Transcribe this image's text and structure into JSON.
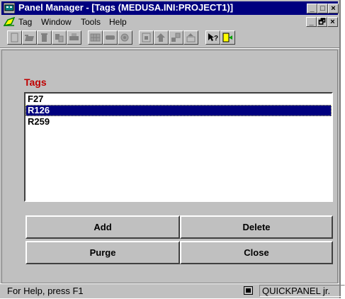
{
  "window": {
    "title": "Panel Manager - [Tags (MEDUSA.INI:PROJECT1)]",
    "minimize_label": "_",
    "restore_label": "□",
    "close_label": "×",
    "child_minimize_label": "_",
    "child_restore_label": "🗗",
    "child_close_label": "×"
  },
  "menu": {
    "items": [
      {
        "label": "Tag"
      },
      {
        "label": "Window"
      },
      {
        "label": "Tools"
      },
      {
        "label": "Help"
      }
    ]
  },
  "toolbar": {
    "icons": [
      "new-icon",
      "open-icon",
      "delete-icon",
      "cut-paste-icon",
      "print-icon",
      "grid-icon",
      "tag-icon",
      "settings-icon",
      "bring-front-icon",
      "up-arrow-icon",
      "layout-icon",
      "export-icon",
      "context-help-icon",
      "exit-icon"
    ]
  },
  "tags": {
    "label": "Tags",
    "items": [
      "F27",
      "R126",
      "R259"
    ],
    "selected_index": 1
  },
  "buttons": {
    "add": "Add",
    "delete": "Delete",
    "purge": "Purge",
    "close": "Close"
  },
  "status": {
    "help_text": "For Help, press F1",
    "pane_text": "QUICKPANEL jr."
  }
}
